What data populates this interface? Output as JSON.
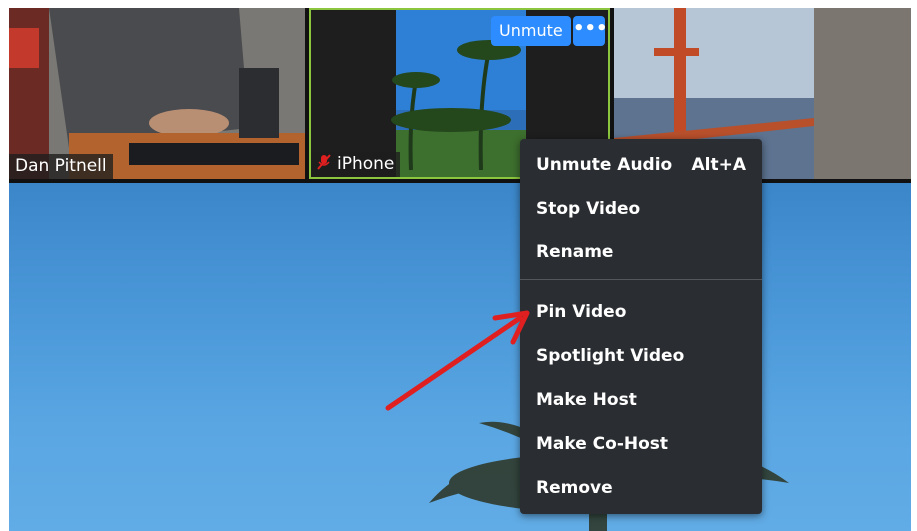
{
  "participants": [
    {
      "name": "Dan Pitnell",
      "muted": false
    },
    {
      "name": "iPhone",
      "muted": true
    },
    {
      "name": "",
      "muted": false
    }
  ],
  "tile_controls": {
    "unmute_label": "Unmute",
    "more_label": "•••"
  },
  "context_menu": {
    "items": [
      {
        "label": "Unmute Audio",
        "shortcut": "Alt+A"
      },
      {
        "label": "Stop Video",
        "shortcut": ""
      },
      {
        "label": "Rename",
        "shortcut": ""
      },
      {
        "label": "Pin Video",
        "shortcut": ""
      },
      {
        "label": "Spotlight Video",
        "shortcut": ""
      },
      {
        "label": "Make Host",
        "shortcut": ""
      },
      {
        "label": "Make Co-Host",
        "shortcut": ""
      },
      {
        "label": "Remove",
        "shortcut": ""
      }
    ]
  },
  "colors": {
    "accent": "#2d8cff",
    "active_border": "#8cc63f",
    "annotation_arrow": "#e02020",
    "menu_bg": "#2a2d31"
  },
  "icons": {
    "muted": "mic-muted-icon",
    "more": "more-options-icon"
  }
}
